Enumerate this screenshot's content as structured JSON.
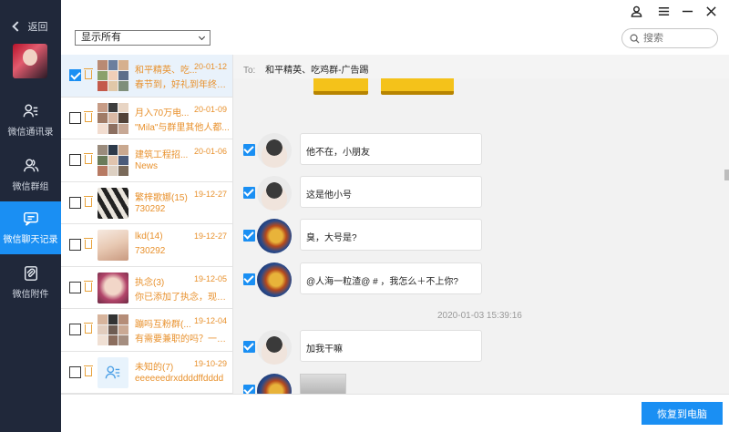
{
  "nav": {
    "back_label": "返回",
    "items": [
      {
        "label": "微信通讯录",
        "icon": "contacts-icon"
      },
      {
        "label": "微信群组",
        "icon": "group-icon"
      },
      {
        "label": "微信聊天记录",
        "icon": "chat-icon"
      },
      {
        "label": "微信附件",
        "icon": "attachment-icon"
      }
    ],
    "active_index": 2
  },
  "toolbar": {
    "filter_value": "显示所有",
    "search_placeholder": "搜索"
  },
  "conversations": [
    {
      "name": "和平精英、吃...",
      "date": "20-01-12",
      "preview": "春节到，好礼到年终奖...",
      "checked": true
    },
    {
      "name": "月入70万电...",
      "date": "20-01-09",
      "preview": "\"Mila\"与群里其他人都...",
      "checked": false
    },
    {
      "name": "建筑工程招...",
      "date": "20-01-06",
      "preview": "News",
      "checked": false
    },
    {
      "name": "繁梓歌娜(15)",
      "date": "19-12-27",
      "preview": "730292",
      "checked": false
    },
    {
      "name": "lkd(14)",
      "date": "19-12-27",
      "preview": "730292",
      "checked": false
    },
    {
      "name": "执念(3)",
      "date": "19-12-05",
      "preview": "你已添加了执念，现在...",
      "checked": false
    },
    {
      "name": "蹦吗互粉群(...",
      "date": "19-12-04",
      "preview": "有需要兼职的吗？一任...",
      "checked": false
    },
    {
      "name": "未知的(7)",
      "date": "19-10-29",
      "preview": "eeeeeedrxddddffdddd",
      "checked": false
    }
  ],
  "chat": {
    "to_label": "To:",
    "to_value": "和平精英、吃鸡群-广告踢",
    "messages": [
      {
        "text": "他不在，小朋友",
        "avatar": "boy"
      },
      {
        "text": "这是他小号",
        "avatar": "boy"
      },
      {
        "text": "臭，大号是?",
        "avatar": "fire"
      },
      {
        "text": "@人海一粒渣@ # ，我怎么＋不上你?",
        "avatar": "fire"
      },
      {
        "text": "加我干嘛",
        "avatar": "boy"
      }
    ],
    "timestamp": "2020-01-03 15:39:16"
  },
  "footer": {
    "restore_label": "恢复到电脑"
  },
  "colors": {
    "nav_bg": "#20283a",
    "accent": "#1a8ff3",
    "list_text": "#e8912d"
  }
}
